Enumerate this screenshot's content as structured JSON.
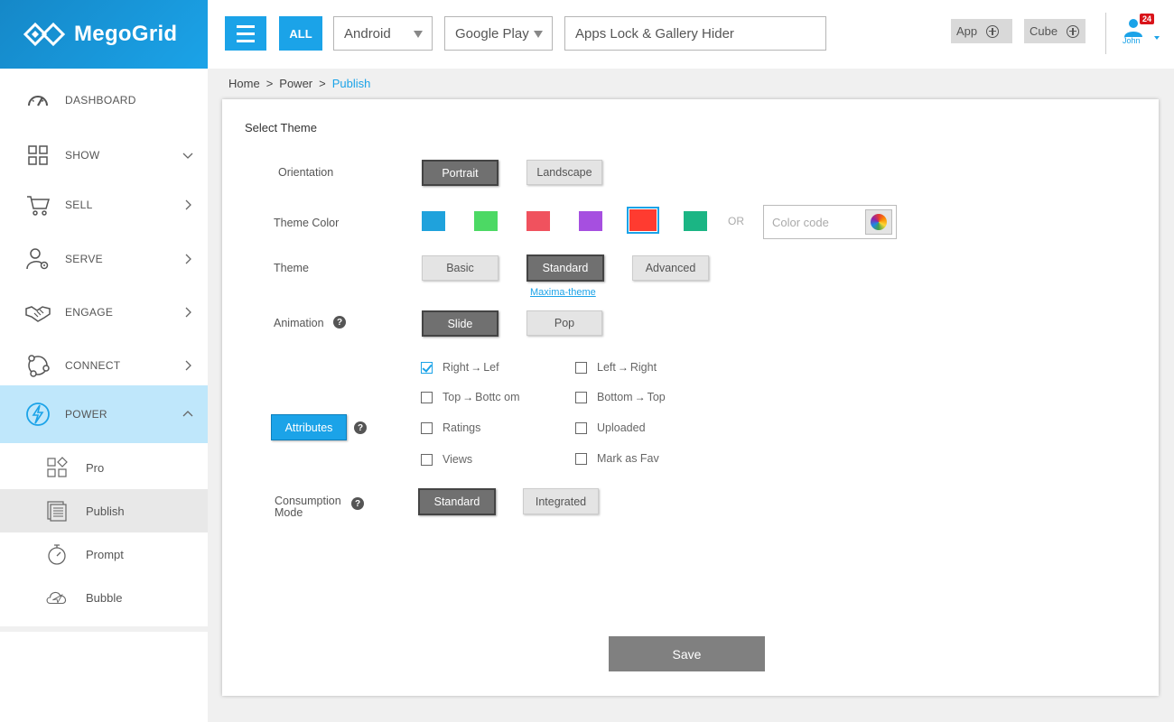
{
  "brand": {
    "name": "MegoGrid"
  },
  "topbar": {
    "all_label": "ALL",
    "platform": "Android",
    "store": "Google Play",
    "app_name": "Apps Lock & Gallery Hider",
    "app_button": "App",
    "cube_button": "Cube",
    "user_name": "John",
    "notification_count": "24"
  },
  "sidebar": {
    "items": [
      {
        "label": "DASHBOARD",
        "icon": "gauge-icon"
      },
      {
        "label": "SHOW",
        "icon": "grid-icon"
      },
      {
        "label": "SELL",
        "icon": "cart-icon"
      },
      {
        "label": "SERVE",
        "icon": "user-gear-icon"
      },
      {
        "label": "ENGAGE",
        "icon": "handshake-icon"
      },
      {
        "label": "CONNECT",
        "icon": "connect-icon"
      },
      {
        "label": "POWER",
        "icon": "lightning-icon"
      }
    ],
    "sub_items": [
      {
        "label": "Pro",
        "icon": "pro-icon"
      },
      {
        "label": "Publish",
        "icon": "publish-icon"
      },
      {
        "label": "Prompt",
        "icon": "stopwatch-icon"
      },
      {
        "label": "Bubble",
        "icon": "cloud-plane-icon"
      }
    ]
  },
  "breadcrumb": {
    "home": "Home",
    "section": "Power",
    "current": "Publish",
    "separator": ">"
  },
  "panel": {
    "title": "Select Theme",
    "orientation": {
      "label": "Orientation",
      "options": [
        "Portrait",
        "Landscape"
      ],
      "selected": "Portrait"
    },
    "theme_color": {
      "label": "Theme Color",
      "swatches": [
        "#1fa2dc",
        "#4cd964",
        "#f0525e",
        "#a64fe0",
        "#ff3b30",
        "#1bb584"
      ],
      "selected_index": 4,
      "or_text": "OR",
      "color_code_placeholder": "Color code"
    },
    "theme": {
      "label": "Theme",
      "options": [
        "Basic",
        "Standard",
        "Advanced"
      ],
      "selected": "Standard",
      "link": "Maxima-theme"
    },
    "animation": {
      "label": "Animation",
      "options": [
        "Slide",
        "Pop"
      ],
      "selected": "Slide",
      "help": "?"
    },
    "attributes": {
      "button": "Attributes",
      "help": "?",
      "arrow": "→",
      "checkboxes": [
        {
          "from": "Right",
          "to": "Lef",
          "checked": true
        },
        {
          "from": "Left",
          "to": "Right",
          "checked": false
        },
        {
          "from": "Top",
          "to": "Bottc om",
          "checked": false
        },
        {
          "from": "Bottom",
          "to": "Top",
          "checked": false
        },
        {
          "text": "Ratings",
          "checked": false
        },
        {
          "text": "Uploaded",
          "checked": false
        },
        {
          "text": "Views",
          "checked": false
        },
        {
          "text": "Mark as Fav",
          "checked": false
        }
      ]
    },
    "consumption": {
      "label_line1": "Consumption",
      "label_line2": "Mode",
      "options": [
        "Standard",
        "Integrated"
      ],
      "selected": "Standard",
      "help": "?"
    },
    "save": "Save"
  },
  "colors": {
    "accent": "#1ba3e8",
    "active_nav": "#bfe7fb",
    "dark_button": "#707070"
  }
}
